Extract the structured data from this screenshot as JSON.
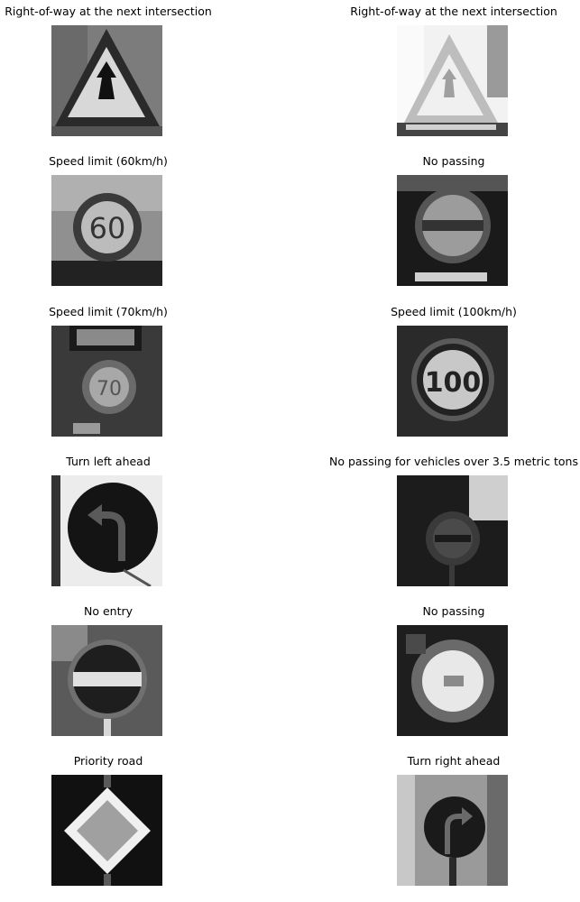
{
  "grid": {
    "cells": [
      {
        "title": "Right-of-way at the next intersection",
        "icon": "right-of-way-sign-icon"
      },
      {
        "title": "Right-of-way at the next intersection",
        "icon": "right-of-way-sign-icon"
      },
      {
        "title": "Speed limit (60km/h)",
        "icon": "speed-limit-60-sign-icon"
      },
      {
        "title": "No passing",
        "icon": "no-passing-sign-icon"
      },
      {
        "title": "Speed limit (70km/h)",
        "icon": "speed-limit-70-sign-icon"
      },
      {
        "title": "Speed limit (100km/h)",
        "icon": "speed-limit-100-sign-icon"
      },
      {
        "title": "Turn left ahead",
        "icon": "turn-left-ahead-sign-icon"
      },
      {
        "title": "No passing for vehicles over 3.5 metric tons",
        "icon": "no-passing-heavy-vehicles-sign-icon"
      },
      {
        "title": "No entry",
        "icon": "no-entry-sign-icon"
      },
      {
        "title": "No passing",
        "icon": "no-passing-sign-icon"
      },
      {
        "title": "Priority road",
        "icon": "priority-road-sign-icon"
      },
      {
        "title": "Turn right ahead",
        "icon": "turn-right-ahead-sign-icon"
      }
    ]
  }
}
